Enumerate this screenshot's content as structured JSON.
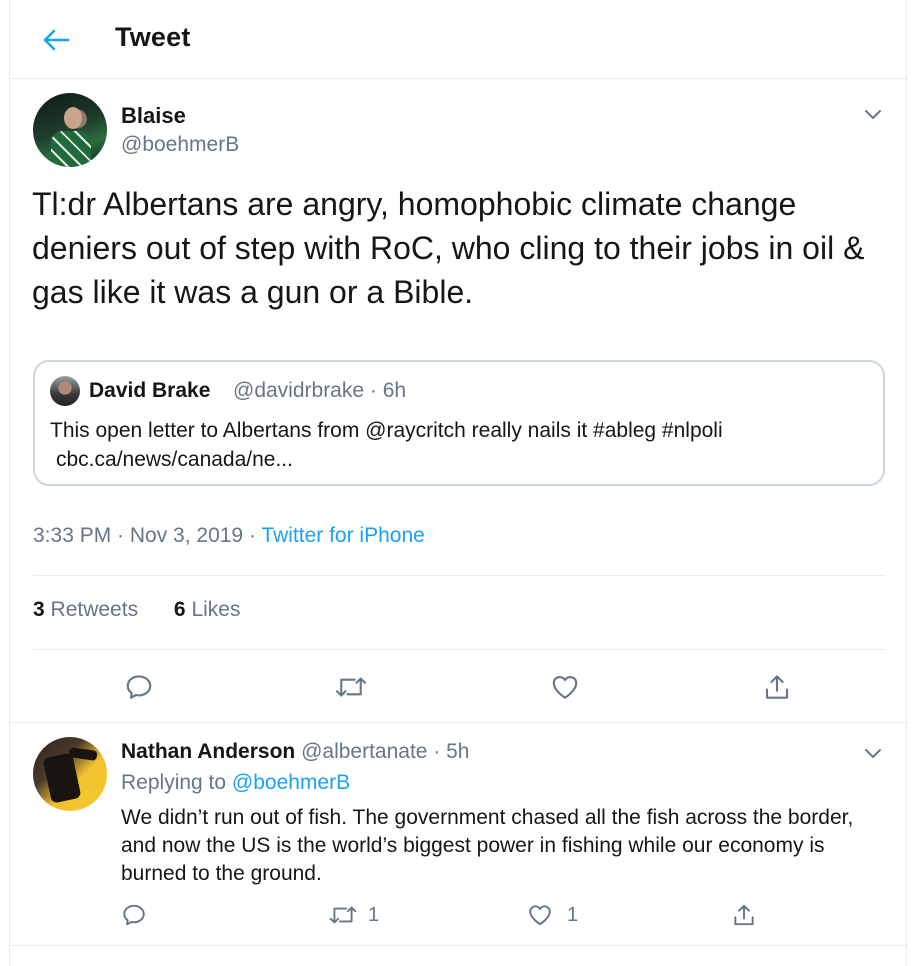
{
  "header": {
    "title": "Tweet"
  },
  "tweet": {
    "author_name": "Blaise",
    "author_handle": "@boehmerB",
    "text": "Tl:dr Albertans are angry, homophobic climate change deniers out of step with RoC, who cling to their jobs in oil & gas like it was a gun or a Bible.",
    "quote": {
      "author_name": "David Brake",
      "author_meta": "@davidrbrake · 6h",
      "text_line1": "This open letter to Albertans from @raycritch really nails it #ableg #nlpoli",
      "text_line2": "cbc.ca/news/canada/ne..."
    },
    "timestamp": "3:33 PM · Nov 3, 2019 · ",
    "source": "Twitter for iPhone",
    "retweets_count": "3",
    "retweets_label": "Retweets",
    "likes_count": "6",
    "likes_label": "Likes"
  },
  "reply": {
    "author_name": "Nathan Anderson",
    "author_meta": " @albertanate · 5h",
    "replying_label": "Replying to ",
    "replying_to": "@boehmerB",
    "text": "We didn’t run out of fish. The government chased all the fish across the border, and now the US is the world’s biggest power in fishing while our economy is burned to the ground.",
    "retweet_count": "1",
    "like_count": "1"
  },
  "colors": {
    "accent": "#1da1f2",
    "muted": "#657786",
    "border": "#e6ecf0",
    "text": "#14171a"
  },
  "icons": [
    "back-arrow-icon",
    "chevron-down-icon",
    "reply-icon",
    "retweet-icon",
    "like-icon",
    "share-icon"
  ]
}
